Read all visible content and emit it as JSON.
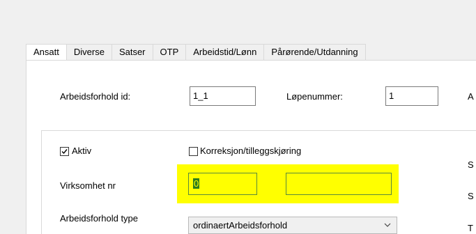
{
  "tabs": [
    "Ansatt",
    "Diverse",
    "Satser",
    "OTP",
    "Arbeidstid/Lønn",
    "Pårørende/Utdanning"
  ],
  "fields": {
    "arbeidsforhold_id_label": "Arbeidsforhold id:",
    "arbeidsforhold_id_value": "1_1",
    "lopenummer_label": "Løpenummer:",
    "lopenummer_value": "1",
    "right_cut_label": "A"
  },
  "group": {
    "aktiv_label": "Aktiv",
    "aktiv_checked": true,
    "korreksjon_label": "Korreksjon/tilleggskjøring",
    "korreksjon_checked": false,
    "virksomhet_label": "Virksomhet nr",
    "virksomhet_value": "0",
    "virksomhet_value2": "",
    "arbeidsforhold_type_label": "Arbeidsforhold type",
    "arbeidsforhold_type_value": "ordinaertArbeidsforhold",
    "right_labels": [
      "S",
      "S",
      "T"
    ]
  },
  "colors": {
    "highlight": "#ffff00",
    "field_border_green": "#5a8a3c",
    "tab_border": "#d9d9d9"
  }
}
